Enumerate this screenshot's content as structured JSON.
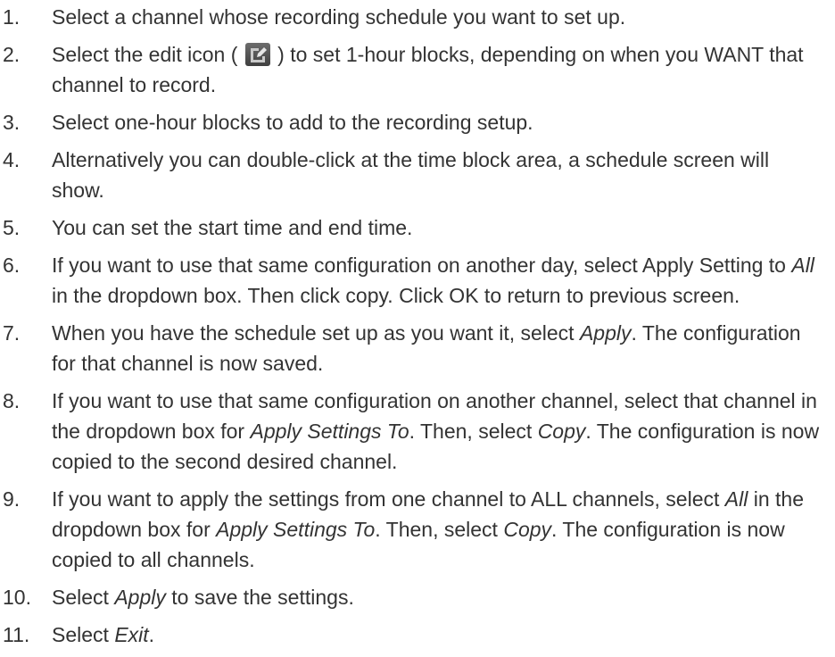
{
  "steps": [
    {
      "num": "1.",
      "parts": [
        {
          "t": "Select a channel whose recording schedule you want to set up."
        }
      ]
    },
    {
      "num": "2.",
      "parts": [
        {
          "t": "Select the edit icon ( "
        },
        {
          "icon": "edit-icon"
        },
        {
          "t": " ) to set 1-hour blocks, depending on when you WANT that channel to record."
        }
      ]
    },
    {
      "num": "3.",
      "parts": [
        {
          "t": "Select one-hour blocks to add to the recording setup."
        }
      ]
    },
    {
      "num": "4.",
      "parts": [
        {
          "t": "Alternatively you can double-click at the time block area, a schedule screen will show."
        }
      ]
    },
    {
      "num": "5.",
      "parts": [
        {
          "t": "You can set the start time and end time."
        }
      ]
    },
    {
      "num": "6.",
      "parts": [
        {
          "t": "If you want to use that same configuration on another day, select Apply Setting to "
        },
        {
          "t": "All",
          "i": true
        },
        {
          "t": " in the dropdown box. Then click copy. Click OK to return to previous screen."
        }
      ]
    },
    {
      "num": "7.",
      "parts": [
        {
          "t": "When you have the schedule set up as you want it, select "
        },
        {
          "t": "Apply",
          "i": true
        },
        {
          "t": ". The configuration for that channel is now saved."
        }
      ]
    },
    {
      "num": "8.",
      "parts": [
        {
          "t": "If you want to use that same configuration on another channel, select that channel in the dropdown box for "
        },
        {
          "t": "Apply Settings To",
          "i": true
        },
        {
          "t": ". Then, select "
        },
        {
          "t": "Copy",
          "i": true
        },
        {
          "t": ". The configuration is now copied to the second desired channel."
        }
      ]
    },
    {
      "num": "9.",
      "parts": [
        {
          "t": "If you want to apply the settings from one channel to ALL channels, select "
        },
        {
          "t": "All",
          "i": true
        },
        {
          "t": " in the dropdown box for "
        },
        {
          "t": "Apply Settings To",
          "i": true
        },
        {
          "t": ". Then, select "
        },
        {
          "t": "Copy",
          "i": true
        },
        {
          "t": ". The configuration is now copied to all channels."
        }
      ]
    },
    {
      "num": "10.",
      "parts": [
        {
          "t": "Select "
        },
        {
          "t": "Apply",
          "i": true
        },
        {
          "t": " to save the settings."
        }
      ]
    },
    {
      "num": "11.",
      "parts": [
        {
          "t": "Select "
        },
        {
          "t": "Exit",
          "i": true
        },
        {
          "t": "."
        }
      ]
    }
  ]
}
